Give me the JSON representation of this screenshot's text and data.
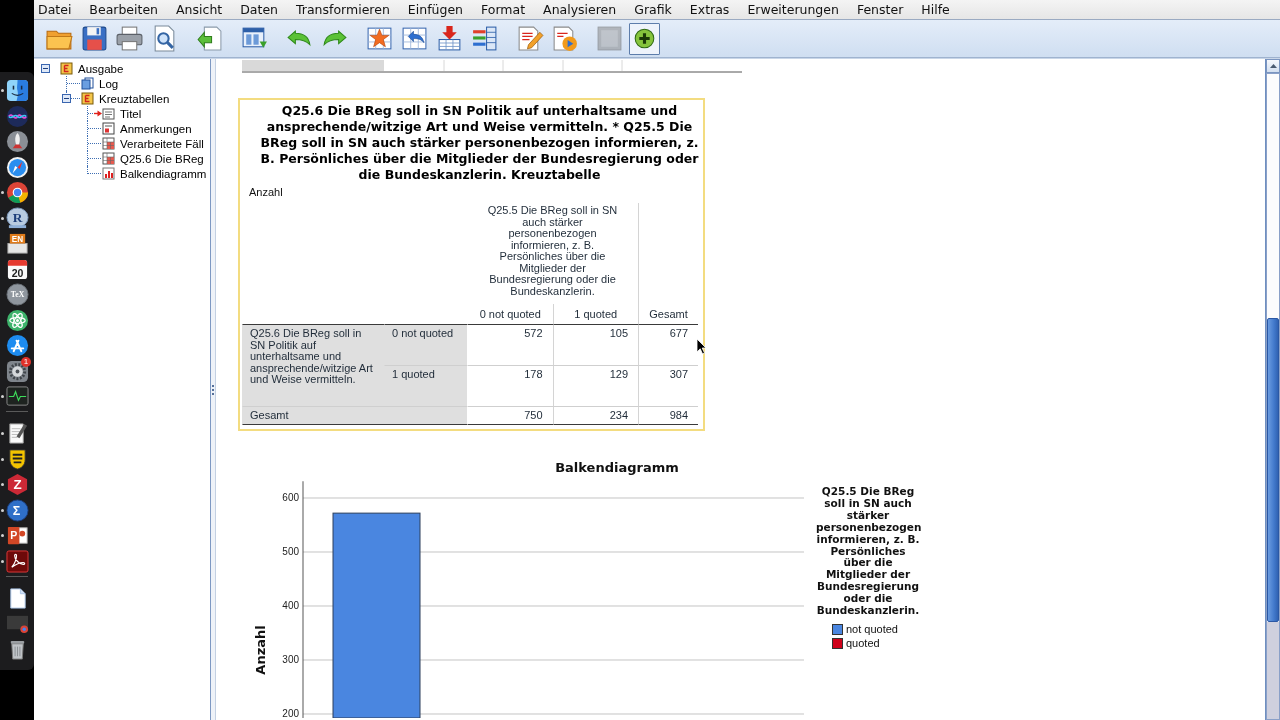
{
  "dock": {
    "sections": [
      {
        "items": [
          {
            "kind": "finder",
            "running": true
          },
          {
            "kind": "siri",
            "running": false
          },
          {
            "kind": "launchpad",
            "running": false
          },
          {
            "kind": "safari",
            "running": false
          },
          {
            "kind": "chrome",
            "running": true
          },
          {
            "kind": "r",
            "glyph": "R",
            "running": true
          },
          {
            "kind": "dictionary",
            "glyph": "EN",
            "running": false
          },
          {
            "kind": "calendar",
            "glyph": "20",
            "running": false
          },
          {
            "kind": "tex",
            "glyph": "TeX",
            "running": false
          },
          {
            "kind": "atom",
            "running": false
          },
          {
            "kind": "appstore",
            "running": false
          },
          {
            "kind": "preferences",
            "badge": "1",
            "running": false
          },
          {
            "kind": "activity",
            "running": true
          }
        ]
      },
      {
        "items": [
          {
            "kind": "textedit",
            "running": true
          },
          {
            "kind": "shield",
            "running": true
          },
          {
            "kind": "zotero",
            "glyph": "Z",
            "running": true
          },
          {
            "kind": "sigma",
            "glyph": "Σ",
            "running": true
          },
          {
            "kind": "powerpoint",
            "glyph": "P",
            "running": true
          },
          {
            "kind": "acrobat",
            "running": true
          }
        ]
      },
      {
        "items": [
          {
            "kind": "documents",
            "running": false
          },
          {
            "kind": "window",
            "running": false
          },
          {
            "kind": "trash",
            "running": false
          }
        ]
      }
    ]
  },
  "menu": {
    "items": [
      "Datei",
      "Bearbeiten",
      "Ansicht",
      "Daten",
      "Transformieren",
      "Einfügen",
      "Format",
      "Analysieren",
      "Grafik",
      "Extras",
      "Erweiterungen",
      "Fenster",
      "Hilfe"
    ]
  },
  "toolbar": {
    "groups": [
      {
        "buttons": [
          {
            "kind": "open",
            "disabled": false,
            "pressed": false
          },
          {
            "kind": "save",
            "disabled": false,
            "pressed": false
          },
          {
            "kind": "print",
            "disabled": false,
            "pressed": false
          },
          {
            "kind": "preview",
            "disabled": false,
            "pressed": false
          }
        ]
      },
      {
        "buttons": [
          {
            "kind": "export",
            "disabled": false,
            "pressed": false
          }
        ]
      },
      {
        "buttons": [
          {
            "kind": "goto-data",
            "disabled": false,
            "pressed": false
          }
        ]
      },
      {
        "buttons": [
          {
            "kind": "undo",
            "disabled": false,
            "pressed": false
          },
          {
            "kind": "redo",
            "disabled": false,
            "pressed": false
          }
        ]
      },
      {
        "buttons": [
          {
            "kind": "star-table",
            "disabled": false,
            "pressed": false
          },
          {
            "kind": "table-back",
            "disabled": false,
            "pressed": false
          },
          {
            "kind": "insert",
            "disabled": false,
            "pressed": false
          },
          {
            "kind": "pivot",
            "disabled": false,
            "pressed": false
          }
        ]
      },
      {
        "buttons": [
          {
            "kind": "edit-page",
            "disabled": false,
            "pressed": false
          },
          {
            "kind": "play-page",
            "disabled": false,
            "pressed": false
          }
        ]
      },
      {
        "buttons": [
          {
            "kind": "blank",
            "disabled": true,
            "pressed": false
          },
          {
            "kind": "add",
            "disabled": false,
            "pressed": true
          }
        ]
      }
    ]
  },
  "outline": {
    "items": [
      {
        "label": "Ausgabe",
        "kind": "book",
        "expanded": true,
        "current": false,
        "children": [
          {
            "label": "Log",
            "kind": "log",
            "current": false
          },
          {
            "label": "Kreuztabellen",
            "kind": "book",
            "expanded": true,
            "current": false,
            "children": [
              {
                "label": "Titel",
                "kind": "title",
                "current": true
              },
              {
                "label": "Anmerkungen",
                "kind": "notes",
                "current": false
              },
              {
                "label": "Verarbeitete Fäll",
                "kind": "table",
                "current": false
              },
              {
                "label": "Q25.6 Die BReg",
                "kind": "table",
                "current": false
              },
              {
                "label": "Balkendiagramm",
                "kind": "chart",
                "current": false
              }
            ]
          }
        ]
      }
    ]
  },
  "output": {
    "pivot_table": {
      "selected": true,
      "title": "Q25.6 Die BReg soll in SN Politik auf unterhaltsame und ansprechende/witzige Art und Weise vermitteln. * Q25.5 Die BReg soll in SN auch stärker personenbezogen informieren, z. B. Persönliches über die Mitglieder der Bundesregierung oder die Bundeskanzlerin. Kreuztabelle",
      "caption": "Anzahl",
      "column_variable": "Q25.5 Die BReg soll in SN auch stärker personenbezogen informieren, z. B. Persönliches über die Mitglieder der Bundesregierung oder die Bundeskanzlerin.",
      "columns": [
        "0 not quoted",
        "1 quoted"
      ],
      "total_column": "Gesamt",
      "row_variable": "Q25.6 Die BReg soll in SN Politik auf unterhaltsame und ansprechende/witzige Art und Weise vermitteln.",
      "rows": [
        {
          "label": "0 not quoted",
          "cells": [
            "572",
            "105",
            "677"
          ]
        },
        {
          "label": "1 quoted",
          "cells": [
            "178",
            "129",
            "307"
          ]
        }
      ],
      "total_row": {
        "label": "Gesamt",
        "cells": [
          "750",
          "234",
          "984"
        ]
      }
    },
    "chart": {
      "chart_data": {
        "type": "bar",
        "title": "Balkendiagramm",
        "ylabel": "Anzahl",
        "legend_title": "Q25.5 Die BReg soll in SN auch stärker personenbezogen informieren, z. B. Persönliches über die Mitglieder der Bundesregierung oder die Bundeskanzlerin.",
        "categories": [
          null
        ],
        "series": [
          {
            "name": "not quoted",
            "color": "#4a86e0",
            "values": [
              572
            ]
          },
          {
            "name": "quoted",
            "color": "#d0021b",
            "values": [
              null
            ]
          }
        ],
        "ylim": [
          192.6,
          631
        ],
        "yticks": [
          200,
          300,
          400,
          500,
          600
        ],
        "grid": true,
        "legend": "right"
      }
    }
  }
}
